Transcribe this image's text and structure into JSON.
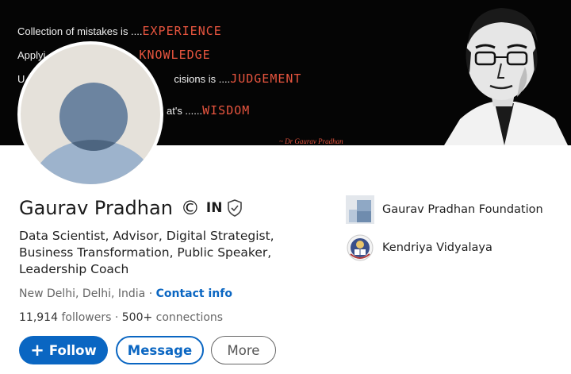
{
  "banner": {
    "line1_prefix": "Collection of mistakes is ....",
    "line1_keyword": "EXPERIENCE",
    "line2_prefix": "Applyi",
    "line2_keyword": "KNOWLEDGE",
    "line3_prefix": "U",
    "line3_mid": "cisions is ....",
    "line3_keyword": "JUDGEMENT",
    "line4_prefix": "at's ......",
    "line4_keyword": "WISDOM",
    "author": "~ Dr Gaurav Pradhan"
  },
  "profile": {
    "name": "Gaurav Pradhan",
    "name_suffix_symbol": "©",
    "name_badge": "IN",
    "headline": "Data Scientist, Advisor, Digital Strategist, Business Transformation, Public Speaker, Leadership Coach",
    "location": "New Delhi, Delhi, India",
    "separator": " · ",
    "contact_label": "Contact info",
    "followers": "11,914",
    "followers_label": "followers",
    "connections_prefix": " · ",
    "connections": "500+",
    "connections_label": "connections"
  },
  "actions": {
    "follow_label": "Follow",
    "follow_icon": "plus-icon",
    "message_label": "Message",
    "more_label": "More"
  },
  "organizations": [
    {
      "name": "Gaurav Pradhan Foundation",
      "icon": "company-logo-icon"
    },
    {
      "name": "Kendriya Vidyalaya",
      "icon": "school-emblem-icon"
    }
  ],
  "colors": {
    "brand_blue": "#0a66c2",
    "banner_keyword": "#e8553f",
    "banner_bg": "#050505"
  }
}
